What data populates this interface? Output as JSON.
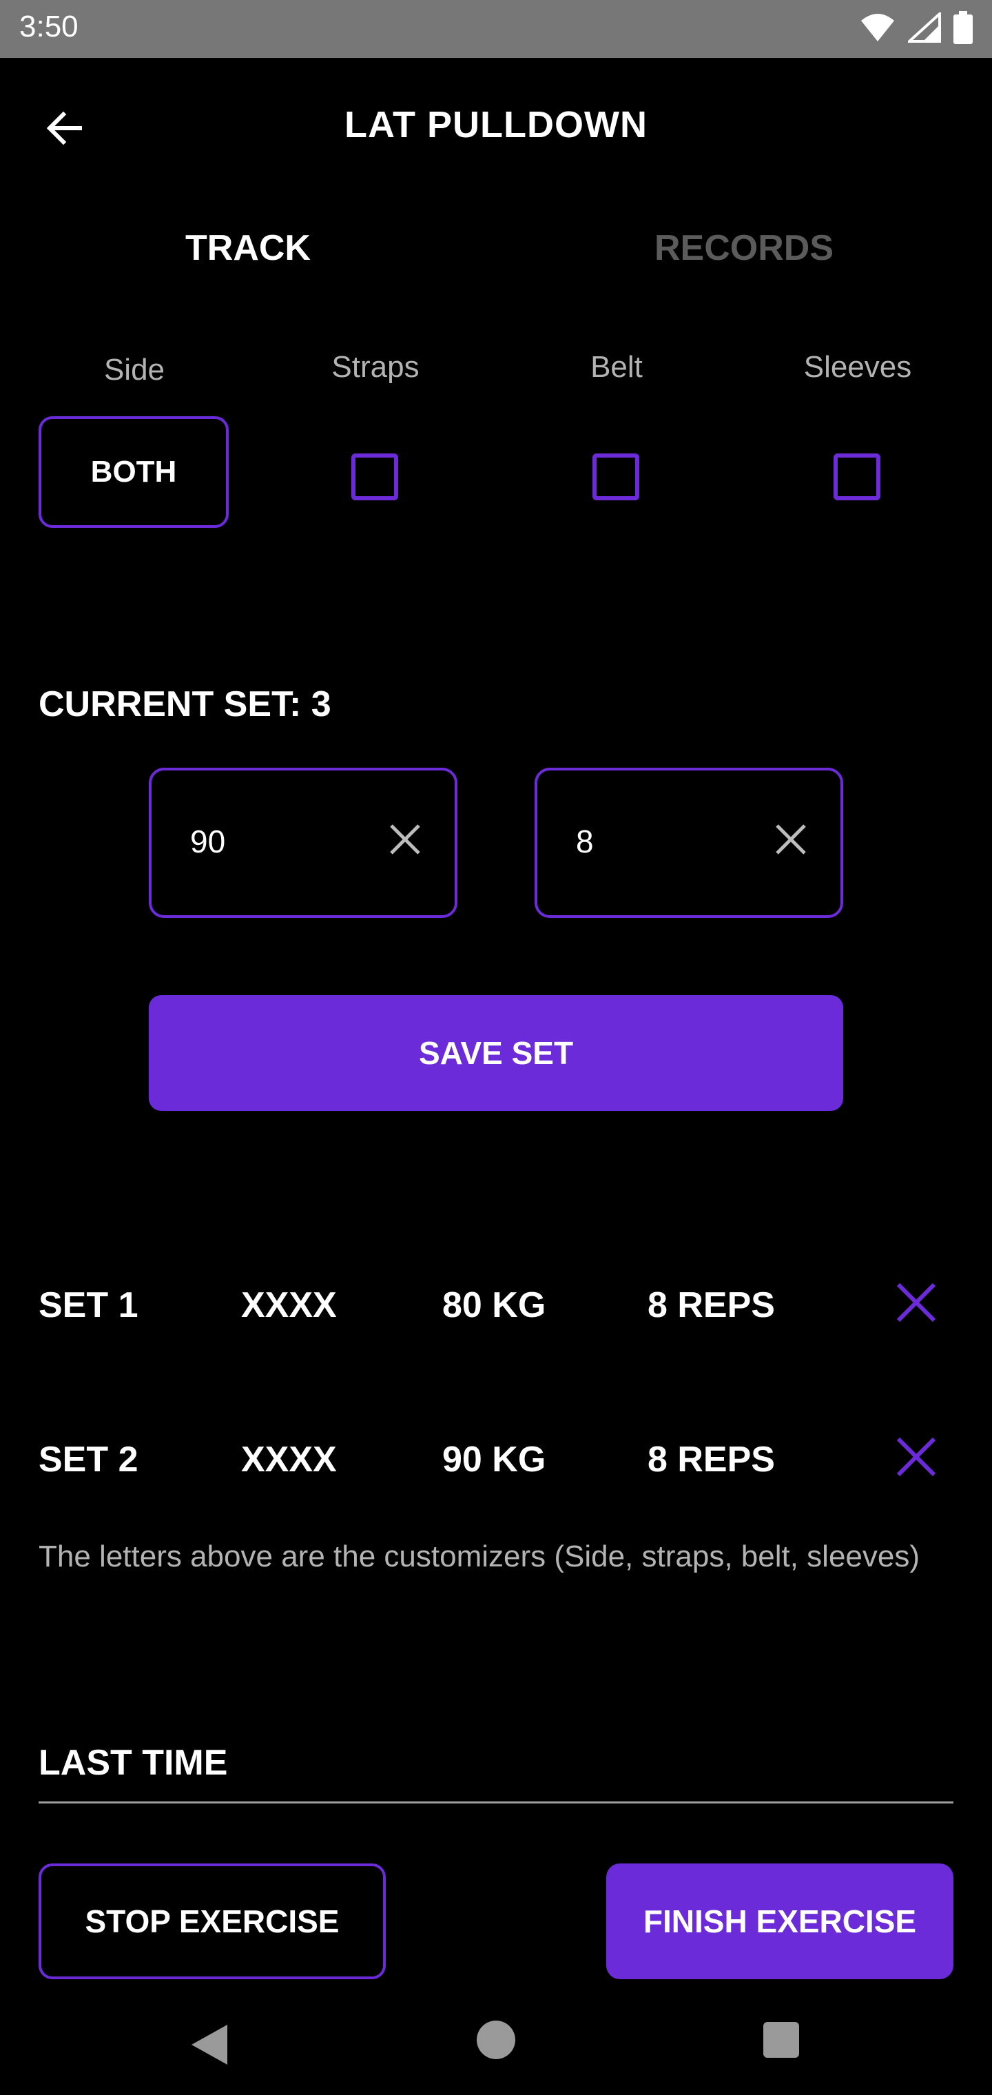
{
  "status": {
    "time": "3:50",
    "icons": [
      "wifi-icon",
      "signal-icon",
      "battery-icon"
    ]
  },
  "appbar": {
    "title": "LAT PULLDOWN",
    "back_icon": "arrow-left-icon"
  },
  "tabs": [
    {
      "label": "TRACK",
      "active": true
    },
    {
      "label": "RECORDS",
      "active": false
    }
  ],
  "customizers": {
    "side_label": "Side",
    "side_value": "BOTH",
    "straps_label": "Straps",
    "belt_label": "Belt",
    "sleeves_label": "Sleeves",
    "straps_checked": false,
    "belt_checked": false,
    "sleeves_checked": false
  },
  "current_set": {
    "label": "CURRENT SET: 3",
    "weight_value": "90",
    "reps_value": "8",
    "save_label": "SAVE SET"
  },
  "sets": [
    {
      "set": "SET 1",
      "custom": "XXXX",
      "weight": "80 KG",
      "reps": "8 REPS"
    },
    {
      "set": "SET 2",
      "custom": "XXXX",
      "weight": "90 KG",
      "reps": "8 REPS"
    }
  ],
  "note": "The letters above are the customizers (Side, straps, belt, sleeves)",
  "last_time": {
    "label": "LAST TIME"
  },
  "actions": {
    "stop_label": "STOP EXERCISE",
    "finish_label": "FINISH EXERCISE"
  },
  "colors": {
    "accent": "#6c2bd9",
    "background": "#000000",
    "muted": "#5b5b5b",
    "status_bar": "#777777"
  },
  "navbar": {
    "icons": [
      "nav-back-icon",
      "nav-home-icon",
      "nav-recents-icon"
    ]
  }
}
